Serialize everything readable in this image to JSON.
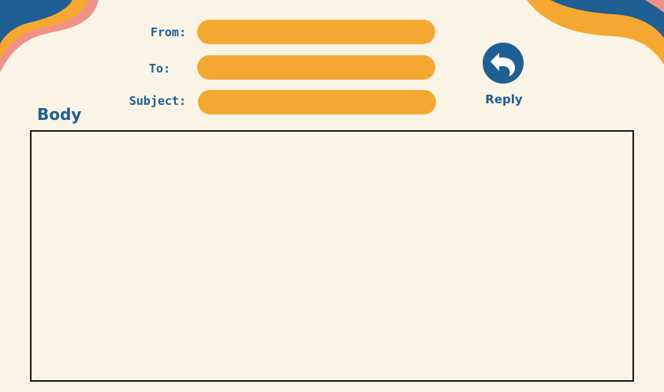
{
  "form": {
    "from": {
      "label": "From:",
      "value": ""
    },
    "to": {
      "label": "To:",
      "value": ""
    },
    "subject": {
      "label": "Subject:",
      "value": ""
    },
    "body": {
      "label": "Body",
      "value": ""
    }
  },
  "reply": {
    "label": "Reply",
    "icon": "reply-arrow-icon"
  },
  "colors": {
    "background": "#faf4e6",
    "field_fill": "#f4a832",
    "accent_blue": "#1f5f93",
    "wave_pink": "#f0928a",
    "wave_orange": "#f4a832"
  }
}
